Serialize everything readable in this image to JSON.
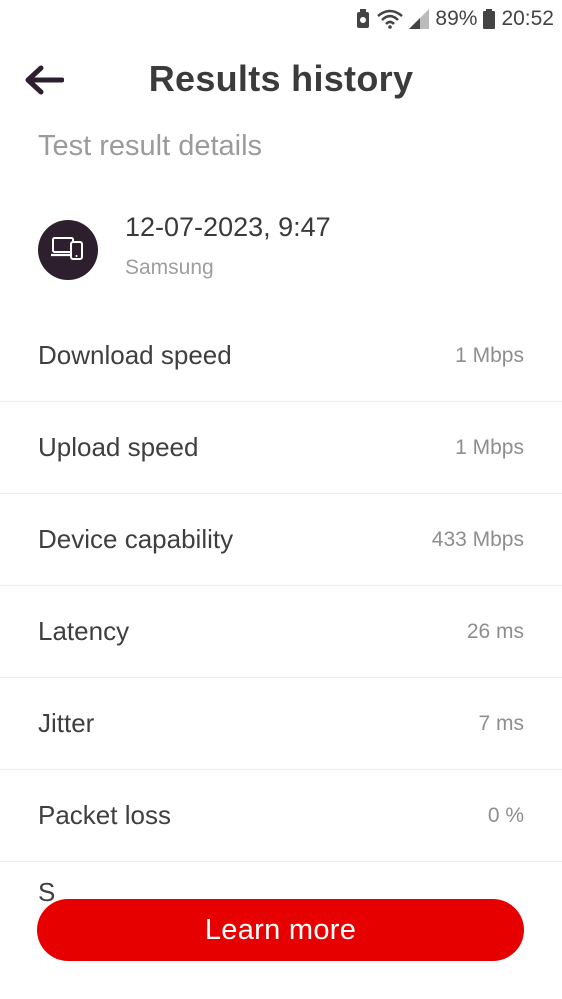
{
  "status_bar": {
    "battery_percent": "89%",
    "time": "20:52",
    "icons": [
      "recycle-icon",
      "wifi-icon",
      "signal-icon",
      "battery-icon"
    ]
  },
  "header": {
    "title": "Results history",
    "back_icon": "back-arrow-icon"
  },
  "section": {
    "title": "Test result details"
  },
  "device": {
    "datetime": "12-07-2023, 9:47",
    "name": "Samsung",
    "icon": "devices-icon"
  },
  "results": [
    {
      "label": "Download speed",
      "value": "1 Mbps"
    },
    {
      "label": "Upload speed",
      "value": "1 Mbps"
    },
    {
      "label": "Device capability",
      "value": "433 Mbps"
    },
    {
      "label": "Latency",
      "value": "26 ms"
    },
    {
      "label": "Jitter",
      "value": "7 ms"
    },
    {
      "label": "Packet loss",
      "value": "0 %"
    }
  ],
  "partial_row_text": "S",
  "cta": {
    "label": "Learn more"
  },
  "colors": {
    "accent": "#e60000",
    "avatar_bg": "#2e1f2e",
    "back_arrow": "#2e1f2e"
  }
}
